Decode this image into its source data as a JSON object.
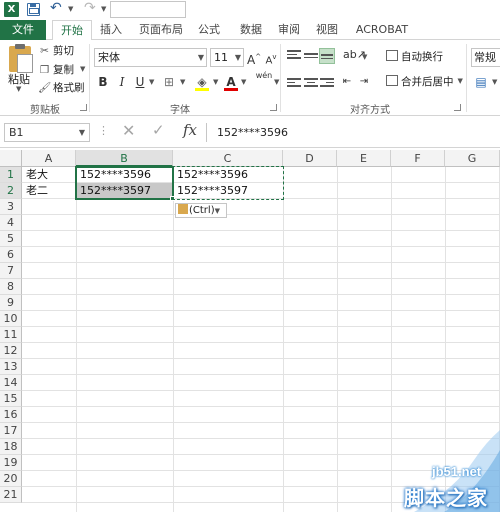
{
  "quick_access": {
    "logo_letter": "X",
    "undo_icon": "undo-icon",
    "redo_icon": "redo-icon"
  },
  "tabs": [
    {
      "label": "文件"
    },
    {
      "label": "开始"
    },
    {
      "label": "插入"
    },
    {
      "label": "页面布局"
    },
    {
      "label": "公式"
    },
    {
      "label": "数据"
    },
    {
      "label": "审阅"
    },
    {
      "label": "视图"
    },
    {
      "label": "ACROBAT"
    }
  ],
  "clipboard": {
    "paste": "粘贴",
    "cut": "剪切",
    "copy": "复制",
    "format_painter": "格式刷",
    "group_label": "剪贴板"
  },
  "font": {
    "name": "宋体",
    "size": "11",
    "grow": "A",
    "shrink": "A",
    "bold": "B",
    "italic": "I",
    "underline": "U",
    "font_color_letter": "A",
    "phonetic": "wén",
    "group_label": "字体"
  },
  "alignment": {
    "wrap_text": "自动换行",
    "merge_center": "合并后居中",
    "group_label": "对齐方式"
  },
  "number": {
    "format": "常规"
  },
  "formula_bar": {
    "name_box": "B1",
    "fx": "fx",
    "formula": "152****3596"
  },
  "sheet": {
    "columns": [
      "A",
      "B",
      "C",
      "D",
      "E",
      "F",
      "G"
    ],
    "rows": [
      "1",
      "2",
      "3",
      "4",
      "5",
      "6",
      "7",
      "8",
      "9",
      "10",
      "11",
      "12",
      "13",
      "14",
      "15",
      "16",
      "17",
      "18",
      "19",
      "20",
      "21"
    ],
    "cells": {
      "A1": "老大",
      "A2": "老二",
      "B1": "152****3596",
      "B2": "152****3597",
      "C1": "152****3596",
      "C2": "152****3597"
    },
    "paste_options": "(Ctrl)"
  },
  "watermark": {
    "url": "jb51.net",
    "site": "脚本之家"
  },
  "colors": {
    "accent": "#217346"
  }
}
